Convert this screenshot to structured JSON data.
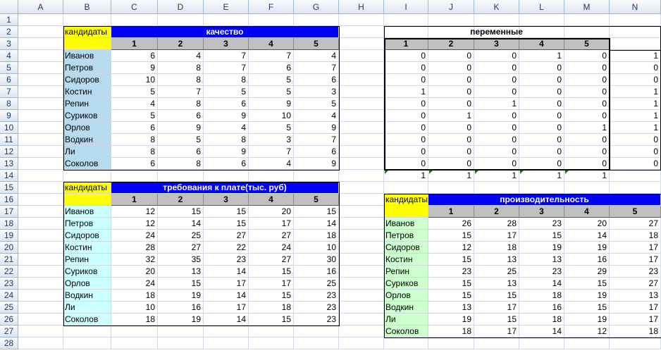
{
  "columns": [
    "A",
    "B",
    "C",
    "D",
    "E",
    "F",
    "G",
    "H",
    "I",
    "J",
    "K",
    "L",
    "M",
    "N"
  ],
  "rows": [
    1,
    2,
    3,
    4,
    5,
    6,
    7,
    8,
    9,
    10,
    11,
    12,
    13,
    14,
    15,
    16,
    17,
    18,
    19,
    20,
    21,
    22,
    23,
    24,
    25,
    26,
    27,
    28
  ],
  "colors": {
    "header_blue": "#0000ff",
    "label_yellow": "#ffff00",
    "names_light_blue": "#b7dbee",
    "names_cyan": "#ccffff",
    "names_green": "#ccffcc",
    "subheader_gray": "#c0c0c0"
  },
  "table_quality": {
    "corner_label": "кандидаты",
    "title": "качество",
    "col_headers": [
      "1",
      "2",
      "3",
      "4",
      "5"
    ],
    "names": [
      "Иванов",
      "Петров",
      "Сидоров",
      "Костин",
      "Репин",
      "Суриков",
      "Орлов",
      "Водкин",
      "Ли",
      "Соколов"
    ],
    "values": [
      [
        6,
        4,
        7,
        7,
        4
      ],
      [
        9,
        8,
        7,
        6,
        7
      ],
      [
        10,
        8,
        8,
        5,
        6
      ],
      [
        5,
        7,
        5,
        5,
        3
      ],
      [
        4,
        8,
        6,
        9,
        5
      ],
      [
        5,
        6,
        9,
        10,
        4
      ],
      [
        6,
        9,
        4,
        5,
        9
      ],
      [
        8,
        5,
        8,
        3,
        7
      ],
      [
        8,
        6,
        9,
        7,
        6
      ],
      [
        6,
        8,
        6,
        4,
        9
      ]
    ]
  },
  "table_vars": {
    "title": "переменные",
    "col_headers": [
      "1",
      "2",
      "3",
      "4",
      "5"
    ],
    "values": [
      [
        0,
        0,
        0,
        1,
        0
      ],
      [
        0,
        0,
        0,
        0,
        0
      ],
      [
        0,
        0,
        0,
        0,
        0
      ],
      [
        1,
        0,
        0,
        0,
        0
      ],
      [
        0,
        0,
        1,
        0,
        0
      ],
      [
        0,
        1,
        0,
        0,
        0
      ],
      [
        0,
        0,
        0,
        0,
        1
      ],
      [
        0,
        0,
        0,
        0,
        0
      ],
      [
        0,
        0,
        0,
        0,
        0
      ],
      [
        0,
        0,
        0,
        0,
        0
      ]
    ],
    "row_sums": [
      1,
      0,
      0,
      1,
      1,
      1,
      1,
      0,
      0,
      0
    ],
    "col_sums": [
      1,
      1,
      1,
      1,
      1
    ]
  },
  "table_salary": {
    "corner_label": "кандидаты",
    "title": "требования к плате(тыс. руб)",
    "col_headers": [
      "1",
      "2",
      "3",
      "4",
      "5"
    ],
    "names": [
      "Иванов",
      "Петров",
      "Сидоров",
      "Костин",
      "Репин",
      "Суриков",
      "Орлов",
      "Водкин",
      "Ли",
      "Соколов"
    ],
    "values": [
      [
        12,
        15,
        15,
        20,
        15
      ],
      [
        12,
        14,
        15,
        17,
        14
      ],
      [
        24,
        25,
        27,
        27,
        18
      ],
      [
        28,
        27,
        22,
        24,
        10
      ],
      [
        32,
        35,
        23,
        27,
        30
      ],
      [
        20,
        13,
        14,
        15,
        16
      ],
      [
        24,
        15,
        17,
        17,
        25
      ],
      [
        18,
        19,
        14,
        15,
        23
      ],
      [
        10,
        16,
        17,
        18,
        23
      ],
      [
        18,
        19,
        14,
        15,
        23
      ]
    ]
  },
  "table_productivity": {
    "corner_label": "кандидаты",
    "title": "производительность",
    "col_headers": [
      "1",
      "2",
      "3",
      "4",
      "5"
    ],
    "names": [
      "Иванов",
      "Петров",
      "Сидоров",
      "Костин",
      "Репин",
      "Суриков",
      "Орлов",
      "Водкин",
      "Ли",
      "Соколов"
    ],
    "values": [
      [
        26,
        28,
        23,
        20,
        27
      ],
      [
        15,
        17,
        15,
        14,
        18
      ],
      [
        12,
        18,
        19,
        19,
        17
      ],
      [
        15,
        13,
        13,
        16,
        17
      ],
      [
        23,
        25,
        23,
        29,
        23
      ],
      [
        15,
        13,
        14,
        15,
        27
      ],
      [
        15,
        15,
        18,
        19,
        13
      ],
      [
        13,
        17,
        16,
        15,
        17
      ],
      [
        19,
        15,
        18,
        19,
        17
      ],
      [
        18,
        17,
        14,
        12,
        18
      ]
    ]
  }
}
